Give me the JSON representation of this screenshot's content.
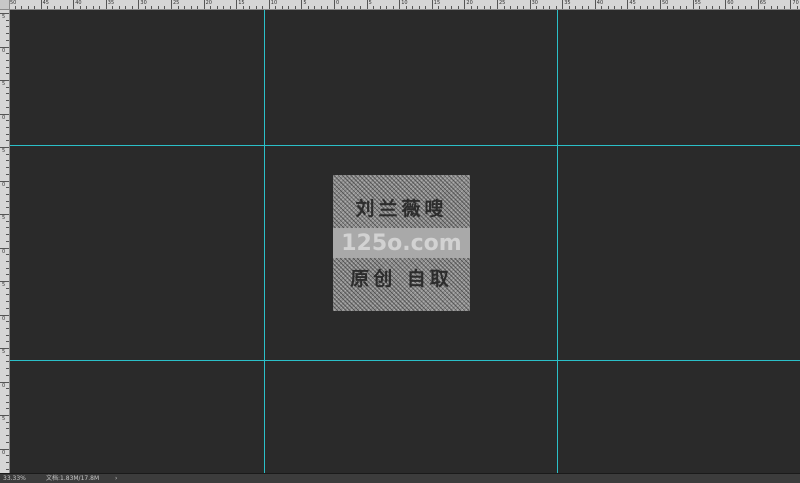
{
  "rulers": {
    "top_labels": [
      "50",
      "45",
      "40",
      "35",
      "30",
      "25",
      "20",
      "15",
      "10",
      "5",
      "0",
      "5",
      "10",
      "15",
      "20",
      "25",
      "30",
      "35",
      "40",
      "45",
      "50",
      "55",
      "60",
      "65",
      "70",
      "75"
    ],
    "left_labels": [
      "5",
      "0",
      "5",
      "0",
      "5",
      "0",
      "5",
      "0",
      "5",
      "0",
      "5",
      "0",
      "5",
      "0"
    ]
  },
  "document": {
    "line1": "刘兰薇嗖",
    "line2": "125o.com",
    "line3": "原创 自取"
  },
  "status": {
    "zoom": "33.33%",
    "doc_info": "文档:1.83M/17.8M",
    "arrow": "›"
  },
  "colors": {
    "guide": "#2bc0c8",
    "canvas": "#2a2a2a",
    "ruler": "#d6d6d6"
  }
}
